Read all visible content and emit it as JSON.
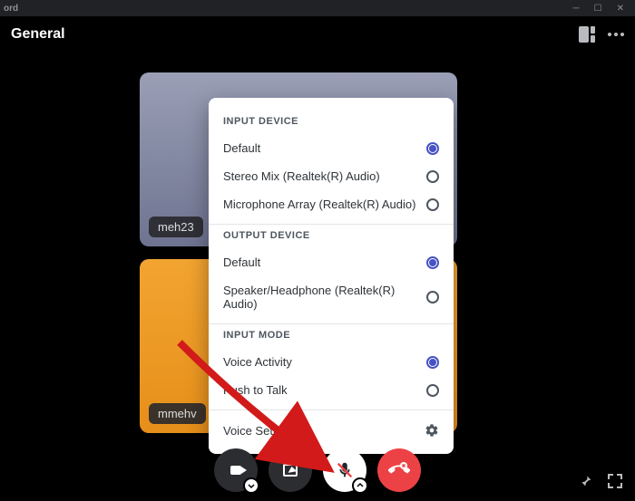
{
  "app": {
    "name": "ord"
  },
  "header": {
    "title": "General"
  },
  "tiles": [
    {
      "username": "meh23"
    },
    {
      "username": "mmehv"
    }
  ],
  "popup": {
    "sections": {
      "input_device": {
        "header": "INPUT DEVICE",
        "options": [
          {
            "label": "Default",
            "selected": true
          },
          {
            "label": "Stereo Mix (Realtek(R) Audio)",
            "selected": false
          },
          {
            "label": "Microphone Array (Realtek(R) Audio)",
            "selected": false
          }
        ]
      },
      "output_device": {
        "header": "OUTPUT DEVICE",
        "options": [
          {
            "label": "Default",
            "selected": true
          },
          {
            "label": "Speaker/Headphone (Realtek(R) Audio)",
            "selected": false
          }
        ]
      },
      "input_mode": {
        "header": "INPUT MODE",
        "options": [
          {
            "label": "Voice Activity",
            "selected": true
          },
          {
            "label": "Push to Talk",
            "selected": false
          }
        ]
      }
    },
    "voice_settings_label": "Voice Settings"
  }
}
